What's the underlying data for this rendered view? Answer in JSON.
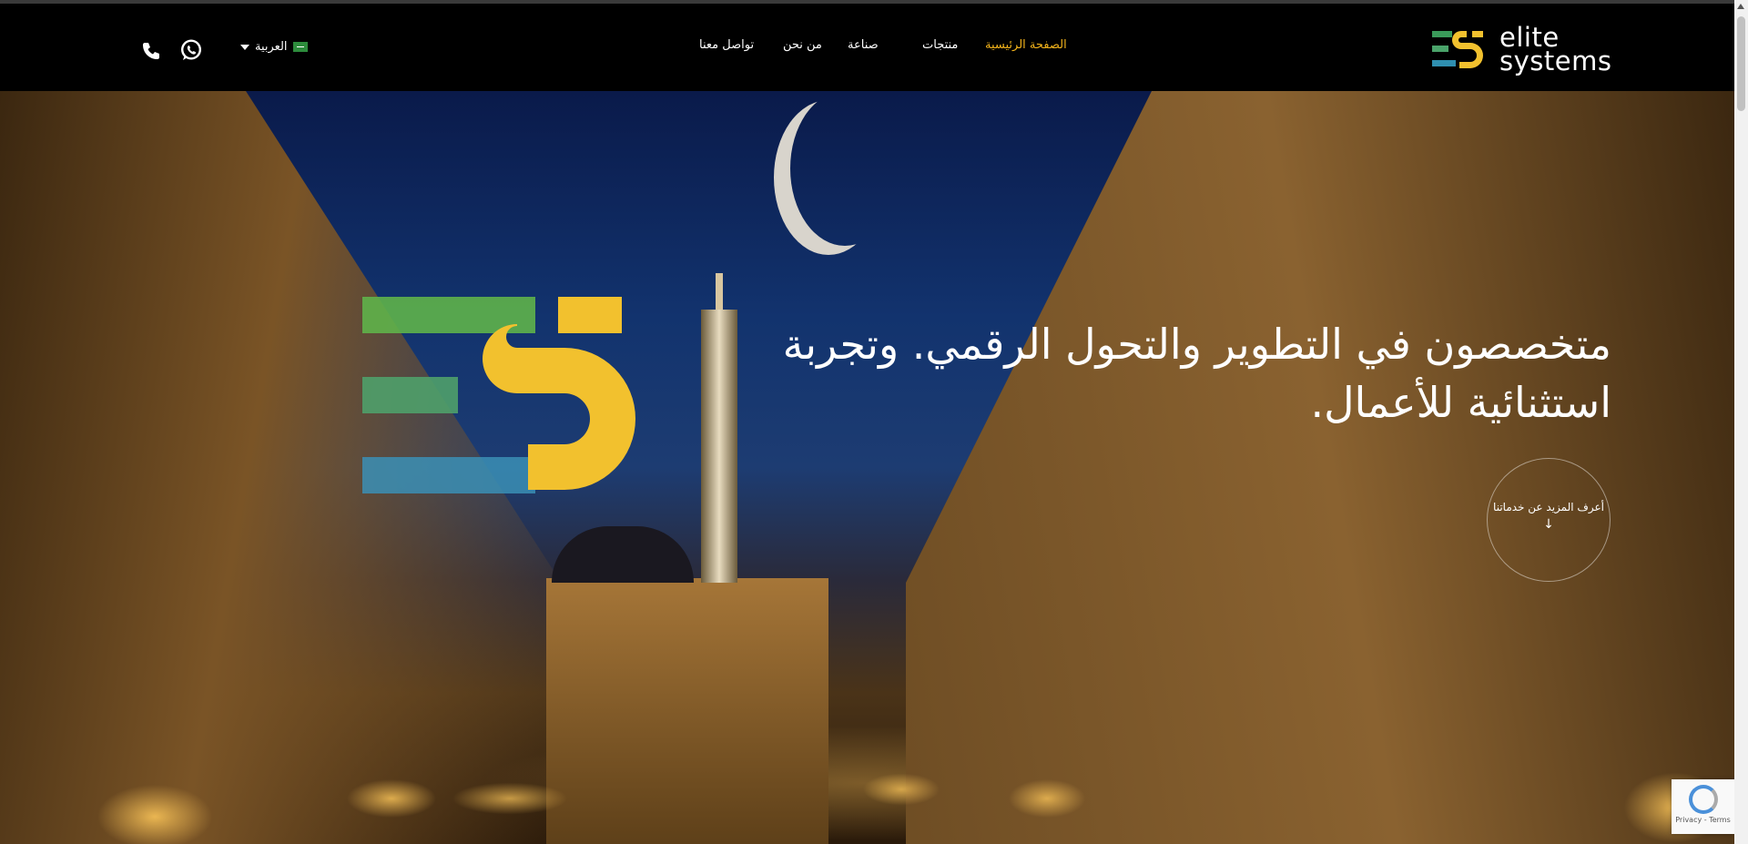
{
  "brand": {
    "line1": "elite",
    "line2": "systems"
  },
  "nav": {
    "items": [
      {
        "label": "الصفحة الرئيسية",
        "active": true
      },
      {
        "label": "منتجات",
        "active": false
      },
      {
        "label": "صناعة",
        "active": false
      },
      {
        "label": "من نحن",
        "active": false
      },
      {
        "label": "تواصل معنا",
        "active": false
      }
    ]
  },
  "language": {
    "label": "العربية",
    "flag_icon": "saudi-flag-icon"
  },
  "contact": {
    "whatsapp_icon": "whatsapp-icon",
    "phone_icon": "phone-icon"
  },
  "hero": {
    "headline": "متخصصون في التطوير والتحول الرقمي. وتجربة استثنائية للأعمال.",
    "cta_label": "أعرف المزيد عن خدماتنا",
    "cta_icon": "arrow-down-icon"
  },
  "recaptcha": {
    "links": "Privacy - Terms"
  },
  "colors": {
    "accent": "#f2b31b",
    "header_bg": "#000000",
    "green": "#5fb24a",
    "blue": "#3a8fd0",
    "yellow": "#f2c12e"
  }
}
